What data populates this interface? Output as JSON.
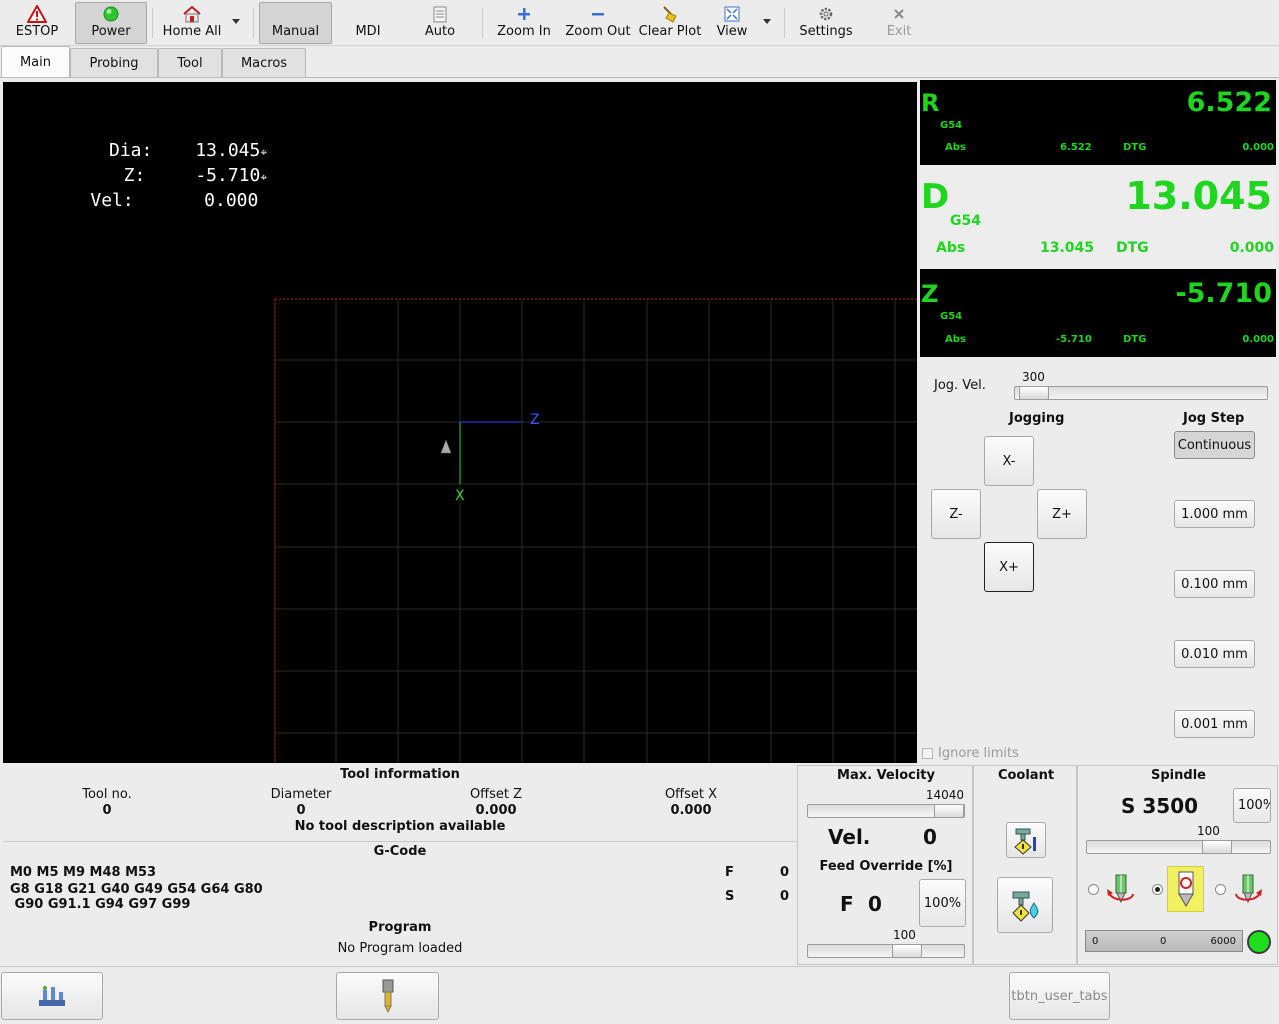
{
  "toolbar": {
    "estop": "ESTOP",
    "power": "Power",
    "home_all": "Home All",
    "manual": "Manual",
    "mdi": "MDI",
    "auto": "Auto",
    "zoom_in": "Zoom In",
    "zoom_out": "Zoom Out",
    "clear_plot": "Clear Plot",
    "view": "View",
    "settings": "Settings",
    "exit": "Exit"
  },
  "tabs": [
    "Main",
    "Probing",
    "Tool",
    "Macros"
  ],
  "preview": {
    "dro": [
      {
        "label": "Dia:",
        "value": "13.045"
      },
      {
        "label": "Z:",
        "value": "-5.710"
      },
      {
        "label": "Vel:",
        "value": "0.000"
      }
    ],
    "axis_z": "Z",
    "axis_x": "X"
  },
  "dro": {
    "r": {
      "letter": "R",
      "wcs": "G54",
      "abs_label": "Abs",
      "abs": "6.522",
      "dtg_label": "DTG",
      "dtg": "0.000",
      "value": "6.522"
    },
    "d": {
      "letter": "D",
      "wcs": "G54",
      "abs_label": "Abs",
      "abs": "13.045",
      "dtg_label": "DTG",
      "dtg": "0.000",
      "value": "13.045"
    },
    "z": {
      "letter": "Z",
      "wcs": "G54",
      "abs_label": "Abs",
      "abs": "-5.710",
      "dtg_label": "DTG",
      "dtg": "0.000",
      "value": "-5.710"
    }
  },
  "jog": {
    "vel_label": "Jog. Vel.",
    "vel_value": "300",
    "jogging_title": "Jogging",
    "step_title": "Jog Step",
    "x_minus": "X-",
    "x_plus": "X+",
    "z_minus": "Z-",
    "z_plus": "Z+",
    "steps": [
      "Continuous",
      "1.000 mm",
      "0.100 mm",
      "0.010 mm",
      "0.001 mm"
    ],
    "ignore_limits": "Ignore limits"
  },
  "tool_info": {
    "title": "Tool information",
    "tool_no_label": "Tool no.",
    "tool_no": "0",
    "diameter_label": "Diameter",
    "diameter": "0",
    "offset_z_label": "Offset Z",
    "offset_z": "0.000",
    "offset_x_label": "Offset X",
    "offset_x": "0.000",
    "description": "No tool description available"
  },
  "gcode": {
    "title": "G-Code",
    "line1": "M0 M5 M9 M48 M53",
    "line2": "G8 G18 G21 G40 G49 G54 G64 G80",
    "line3": " G90 G91.1 G94 G97 G99",
    "f_label": "F",
    "f_value": "0",
    "s_label": "S",
    "s_value": "0"
  },
  "program": {
    "title": "Program",
    "status": "No Program loaded"
  },
  "velocity": {
    "title": "Max. Velocity",
    "max_value": "14040",
    "vel_label": "Vel.",
    "vel_value": "0",
    "feed_title": "Feed Override [%]",
    "feed_label": "F",
    "feed_value": "0",
    "feed_reset": "100%",
    "feed_slider": "100"
  },
  "coolant": {
    "title": "Coolant"
  },
  "spindle": {
    "title": "Spindle",
    "speed": "S 3500",
    "override_btn": "100%",
    "override_value": "100",
    "bar_min": "0",
    "bar_value": "0",
    "bar_max": "6000"
  },
  "bottom": {
    "user_tabs": "tbtn_user_tabs"
  }
}
